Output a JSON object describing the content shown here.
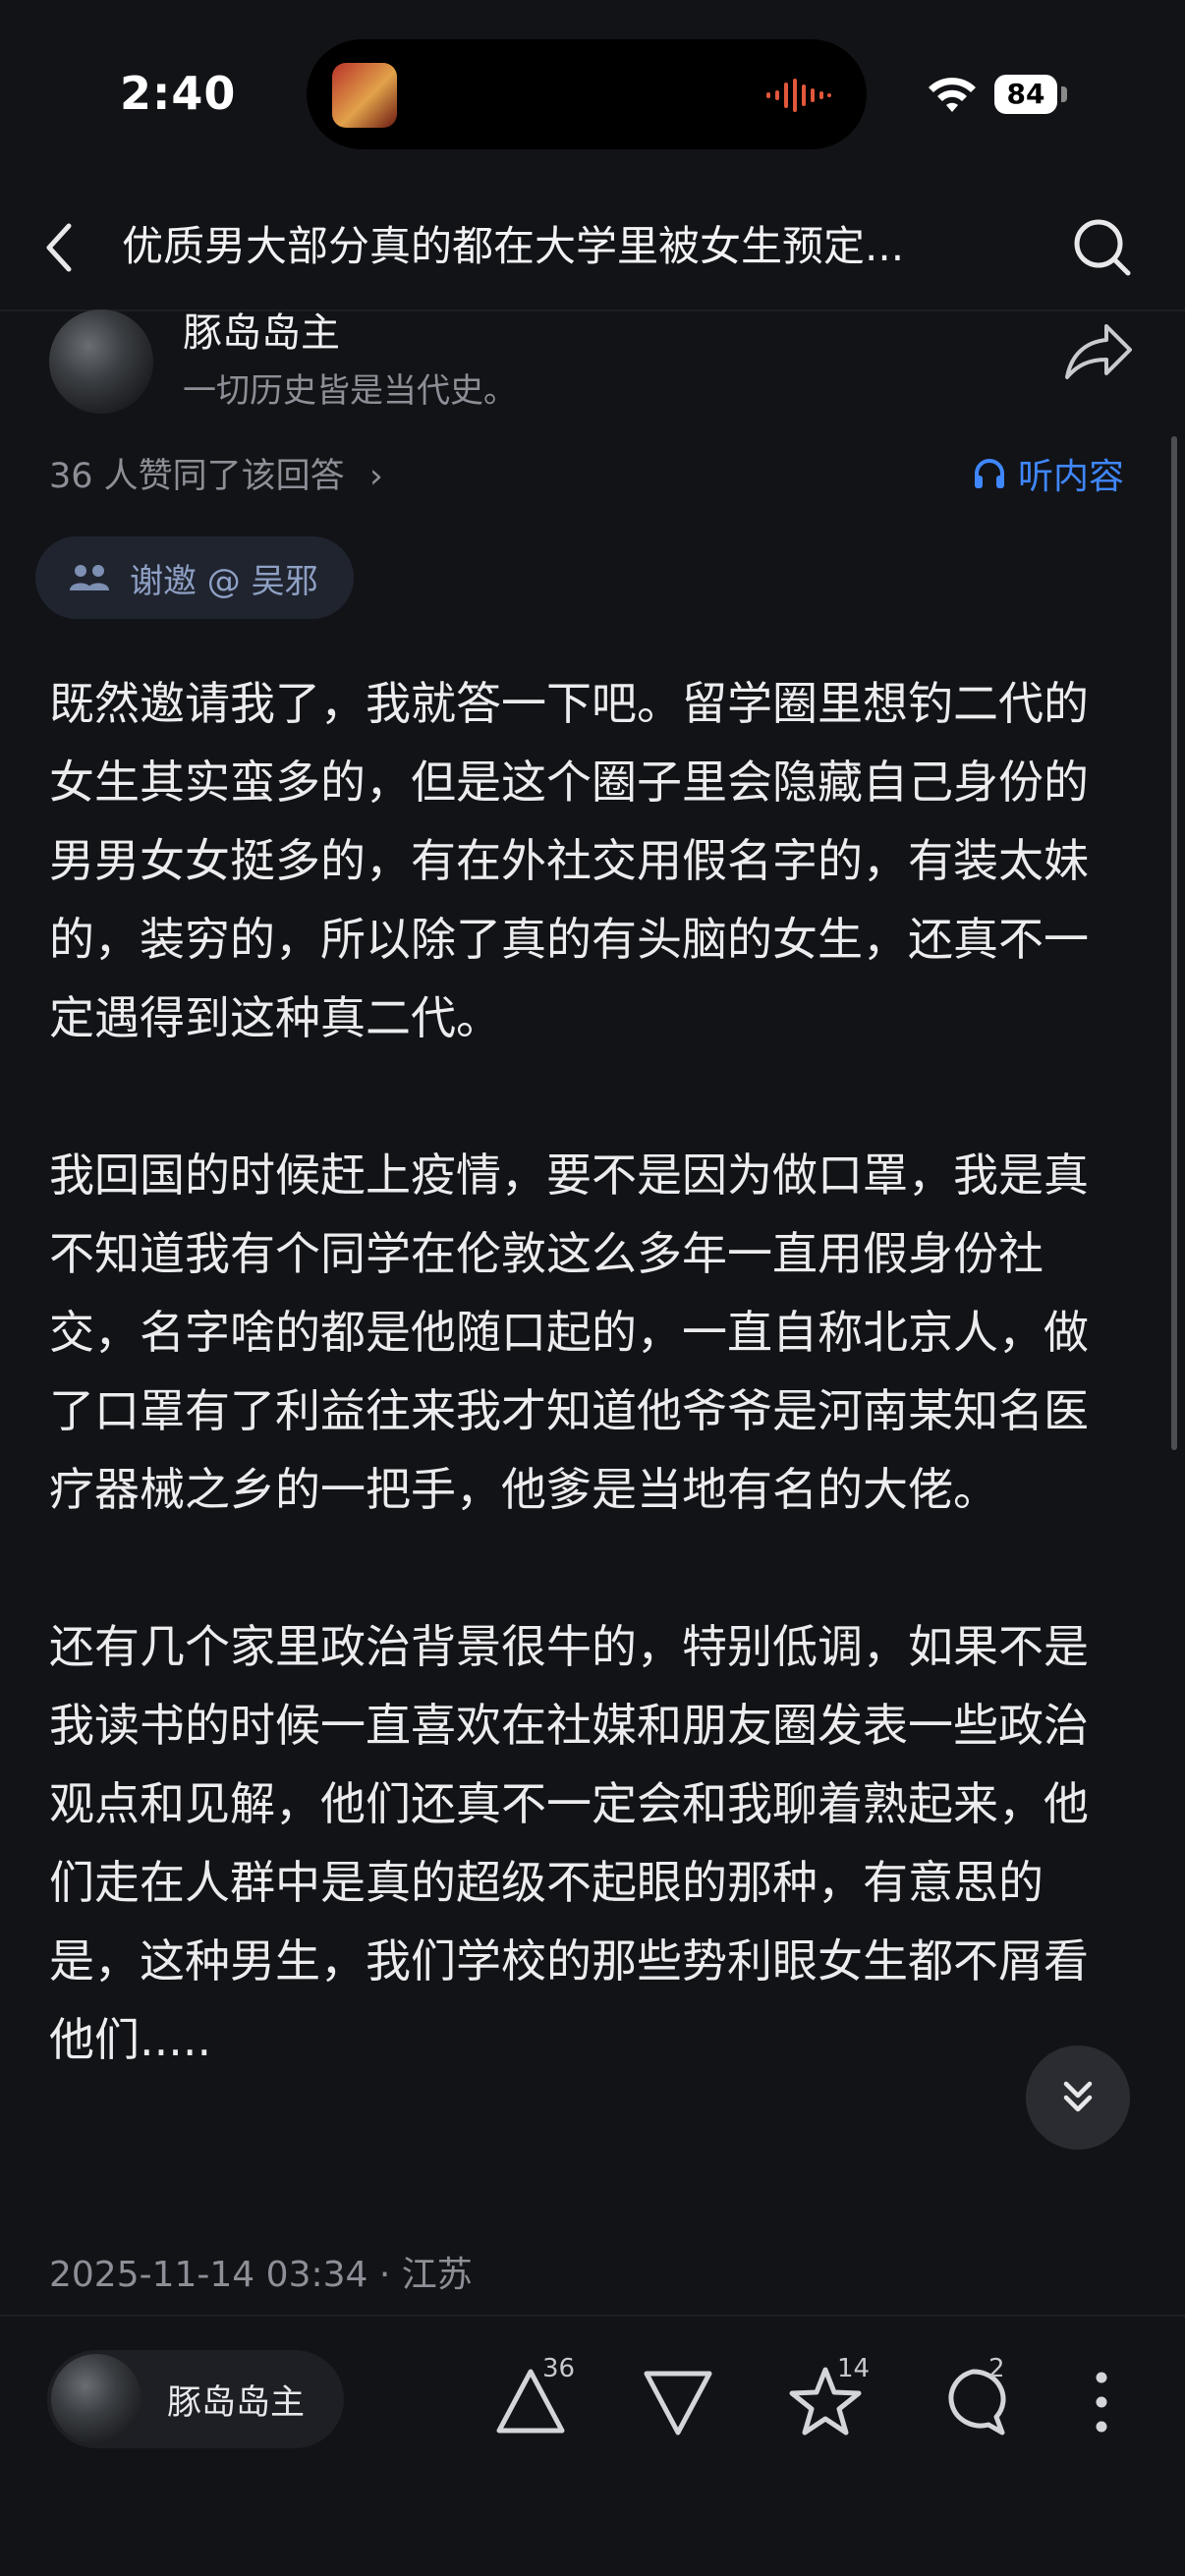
{
  "status_bar": {
    "time": "2:40",
    "battery": "84"
  },
  "nav": {
    "title": "优质男大部分真的都在大学里被女生预定..."
  },
  "author": {
    "name": "豚岛岛主",
    "bio": "一切历史皆是当代史。"
  },
  "answer": {
    "likes_text": "36 人赞同了该回答",
    "listen_label": "听内容",
    "invite_label": "谢邀 @ 吴邪",
    "paragraphs": [
      "既然邀请我了，我就答一下吧。留学圈里想钓二代的女生其实蛮多的，但是这个圈子里会隐藏自己身份的男男女女挺多的，有在外社交用假名字的，有装太妹的，装穷的，所以除了真的有头脑的女生，还真不一定遇得到这种真二代。",
      "我回国的时候赶上疫情，要不是因为做口罩，我是真不知道我有个同学在伦敦这么多年一直用假身份社交，名字啥的都是他随口起的，一直自称北京人，做了口罩有了利益往来我才知道他爷爷是河南某知名医疗器械之乡的一把手，他爹是当地有名的大佬。",
      "还有几个家里政治背景很牛的，特别低调，如果不是我读书的时候一直喜欢在社媒和朋友圈发表一些政治观点和见解，他们还真不一定会和我聊着熟起来，他们走在人群中是真的超级不起眼的那种，有意思的是，这种男生，我们学校的那些势利眼女生都不屑看他们....."
    ],
    "meta": "2025-11-14 03:34 · 江苏"
  },
  "bottom_bar": {
    "author_name": "豚岛岛主",
    "upvote_count": "36",
    "favorite_count": "14",
    "comment_count": "2"
  },
  "icons": {
    "back": "chevron-left-icon",
    "search": "search-icon",
    "share": "share-arrow-icon",
    "listen": "headphones-icon",
    "invite": "invite-icon",
    "expand": "double-chevron-down-icon",
    "upvote": "triangle-up-icon",
    "downvote": "triangle-down-icon",
    "favorite": "star-icon",
    "comment": "comment-bubble-icon",
    "more": "more-vertical-icon"
  },
  "colors": {
    "background": "#121317",
    "accent": "#3f87ff",
    "muted": "#8c8f96"
  }
}
